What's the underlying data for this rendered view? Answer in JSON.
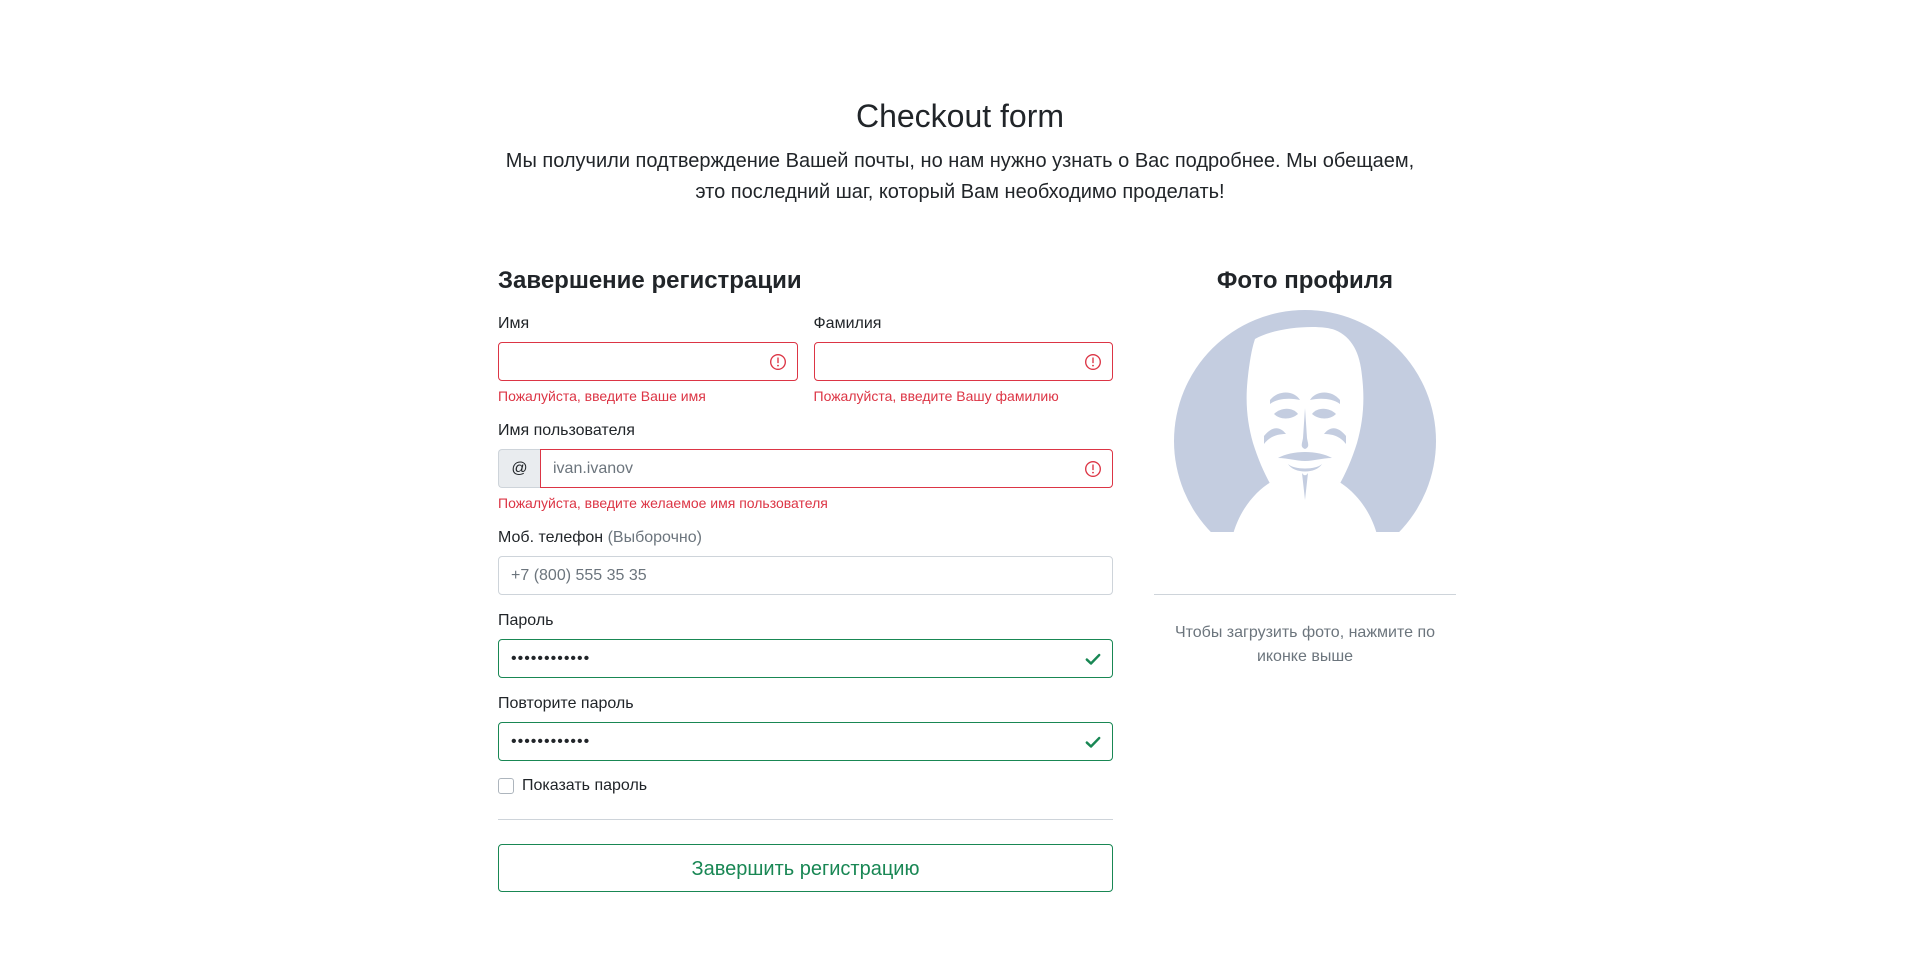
{
  "header": {
    "title": "Checkout form",
    "description": "Мы получили подтверждение Вашей почты, но нам нужно узнать о Вас подробнее. Мы обещаем, это последний шаг, который Вам необходимо проделать!"
  },
  "form": {
    "title": "Завершение регистрации",
    "first_name": {
      "label": "Имя",
      "value": "",
      "placeholder": "",
      "error": "Пожалуйста, введите Ваше имя",
      "state": "invalid"
    },
    "last_name": {
      "label": "Фамилия",
      "value": "",
      "placeholder": "",
      "error": "Пожалуйста, введите Вашу фамилию",
      "state": "invalid"
    },
    "username": {
      "label": "Имя пользователя",
      "prefix": "@",
      "value": "",
      "placeholder": "ivan.ivanov",
      "error": "Пожалуйста, введите желаемое имя пользователя",
      "state": "invalid"
    },
    "phone": {
      "label": "Моб. телефон",
      "label_optional": "(Выборочно)",
      "value": "",
      "placeholder": "+7 (800) 555 35 35"
    },
    "password": {
      "label": "Пароль",
      "value": "••••••••••••",
      "state": "valid"
    },
    "password_repeat": {
      "label": "Повторите пароль",
      "value": "••••••••••••",
      "state": "valid"
    },
    "show_password": {
      "label": "Показать пароль",
      "checked": false
    },
    "submit_label": "Завершить регистрацию"
  },
  "photo": {
    "title": "Фото профиля",
    "hint": "Чтобы загрузить фото, нажмите по иконке выше"
  },
  "icons": {
    "error": "exclamation-circle-icon",
    "valid": "check-icon",
    "avatar": "anonymous-mask-avatar"
  },
  "colors": {
    "invalid": "#dc3545",
    "valid": "#198754",
    "avatar_bg": "#c4cde0",
    "muted": "#6c757d"
  }
}
